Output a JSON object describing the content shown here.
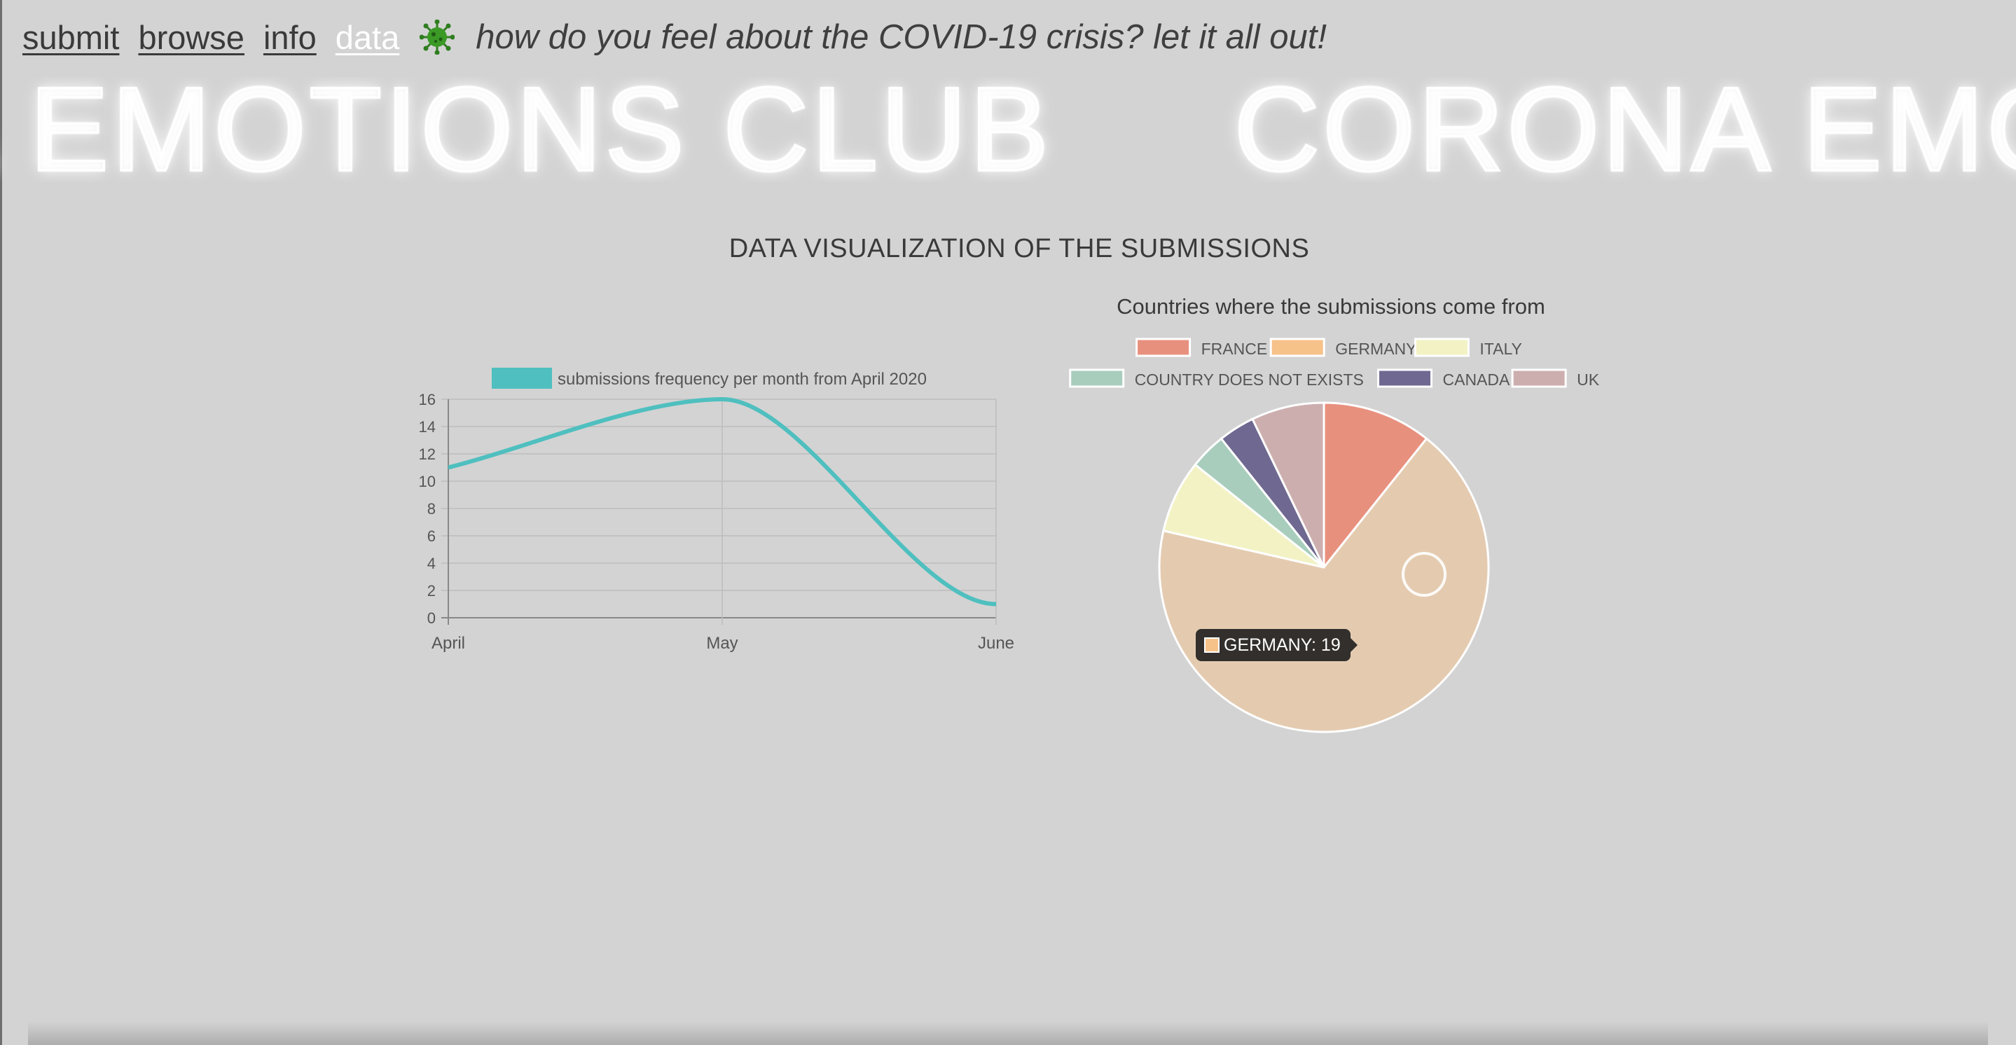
{
  "nav": {
    "links": [
      {
        "label": "submit",
        "active": false
      },
      {
        "label": "browse",
        "active": false
      },
      {
        "label": "info",
        "active": false
      },
      {
        "label": "data",
        "active": true
      }
    ],
    "icon": "virus-icon",
    "tagline": "how do you feel about the COVID-19 crisis? let it all out!"
  },
  "marquee": {
    "text": "CORONA EMOTIONS CLUB"
  },
  "page": {
    "section_title": "DATA VISUALIZATION OF THE SUBMISSIONS"
  },
  "tooltip": {
    "label": "GERMANY: 19",
    "color": "#f7c28a"
  },
  "chart_data": [
    {
      "type": "line",
      "title": "",
      "categories": [
        "April",
        "May",
        "June"
      ],
      "series": [
        {
          "name": "submissions frequency per month from April 2020",
          "values": [
            11,
            16,
            1
          ],
          "color": "#4fbfbf"
        }
      ],
      "ylim": [
        0,
        16
      ],
      "yticks": [
        0,
        2,
        4,
        6,
        8,
        10,
        12,
        14,
        16
      ],
      "legend": "top",
      "grid": true
    },
    {
      "type": "pie",
      "title": "Countries where the submissions come from",
      "legend": "top",
      "slices": [
        {
          "label": "FRANCE",
          "value": 3,
          "color": "#e8907e"
        },
        {
          "label": "GERMANY",
          "value": 19,
          "color": "#f7c28a",
          "display_color": "#e4cbb0"
        },
        {
          "label": "ITALY",
          "value": 2,
          "color": "#f2f2c4"
        },
        {
          "label": "COUNTRY DOES NOT EXISTS",
          "value": 1,
          "color": "#a8cdbd"
        },
        {
          "label": "CANADA",
          "value": 1,
          "color": "#6f6991"
        },
        {
          "label": "UK",
          "value": 2,
          "color": "#cdaeae"
        }
      ]
    }
  ]
}
